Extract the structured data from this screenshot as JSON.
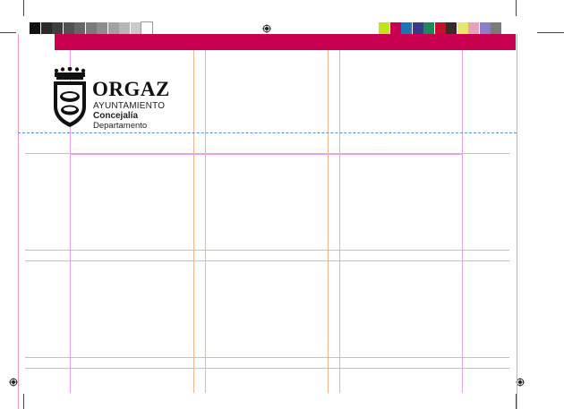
{
  "header_band": {
    "color": "#c8004f"
  },
  "logo": {
    "title": "ORGAZ",
    "line1": "AYUNTAMIENTO",
    "line2": "Concejalía",
    "line3": "Departamento"
  },
  "grayscale_bar": [
    "#111111",
    "#2a2a2a",
    "#3e3e3e",
    "#525252",
    "#666666",
    "#7a7a7a",
    "#8e8e8e",
    "#a2a2a2",
    "#b6b6b6",
    "#cacaca",
    "#ffffff"
  ],
  "color_bar": [
    "#c6e01d",
    "#c8004f",
    "#1f73b7",
    "#3a3a8c",
    "#1b8a5a",
    "#c8102e",
    "#3a2a2a",
    "#e6e86a",
    "#e9a0b8",
    "#8a7ec8",
    "#7a7a7a"
  ],
  "guide_colors": {
    "margin": "#f2b48a",
    "column": "#e4a3e0",
    "bleed": "#5a8fd0"
  }
}
